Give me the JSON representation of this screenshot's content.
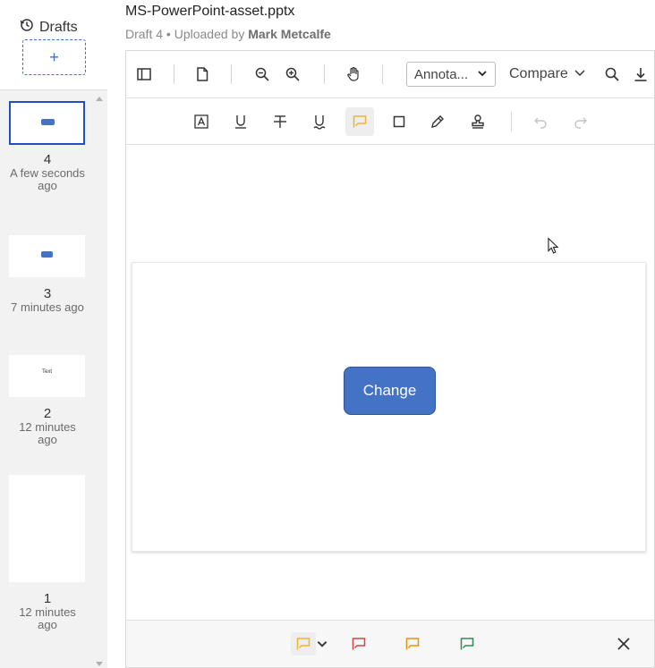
{
  "rail": {
    "title": "Drafts",
    "add_label": "+",
    "drafts": [
      {
        "number": "4",
        "time": "A few seconds ago",
        "selected": true,
        "thumb": "button"
      },
      {
        "number": "3",
        "time": "7 minutes ago",
        "selected": false,
        "thumb": "button"
      },
      {
        "number": "2",
        "time": "12 minutes ago",
        "selected": false,
        "thumb": "text",
        "thumb_text": "Text"
      },
      {
        "number": "1",
        "time": "12 minutes ago",
        "selected": false,
        "thumb": "blank"
      }
    ]
  },
  "header": {
    "file_name": "MS-PowerPoint-asset.pptx",
    "draft_label": "Draft 4",
    "uploaded_prefix": "Uploaded by",
    "uploader": "Mark Metcalfe"
  },
  "toolbar": {
    "annotation_select": "Annota...",
    "compare_label": "Compare"
  },
  "slide": {
    "button_text": "Change"
  },
  "colors": {
    "accent": "#3b6fd4",
    "slide_button": "#4472c4",
    "annot_yellow": "#f0b429",
    "annot_red": "#d64545",
    "annot_orange": "#e8920c",
    "annot_green": "#2e8b57"
  },
  "icons": [
    "history-icon",
    "sidebar-toggle-icon",
    "page-icon",
    "zoom-out-icon",
    "zoom-in-icon",
    "pan-hand-icon",
    "chevron-down-icon",
    "search-icon",
    "download-icon",
    "text-box-icon",
    "underline-icon",
    "strikethrough-icon",
    "squiggly-underline-icon",
    "comment-icon",
    "rectangle-icon",
    "pencil-icon",
    "stamp-icon",
    "undo-icon",
    "redo-icon",
    "close-icon"
  ]
}
